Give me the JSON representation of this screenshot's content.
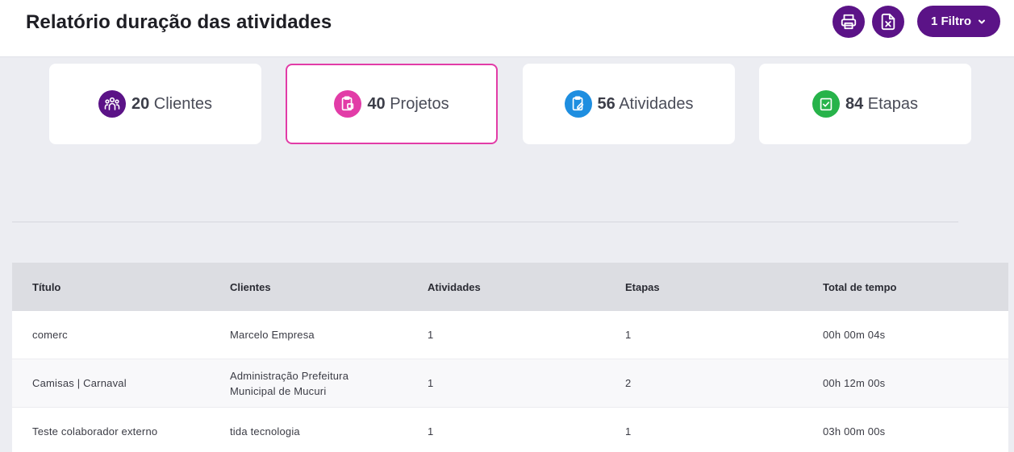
{
  "header": {
    "title": "Relatório duração das atividades",
    "print_icon": "printer-icon",
    "excel_icon": "excel-file-icon",
    "filter_label": "1 Filtro"
  },
  "colors": {
    "brand": "#5b1387",
    "clientes": "#5b1387",
    "projetos": "#e23ca7",
    "atividades": "#1e8ee0",
    "etapas": "#27b34a"
  },
  "cards": [
    {
      "count": "20",
      "label": "Clientes",
      "icon": "users-group-icon"
    },
    {
      "count": "40",
      "label": "Projetos",
      "icon": "clipboard-icon"
    },
    {
      "count": "56",
      "label": "Atividades",
      "icon": "clipboard-edit-icon"
    },
    {
      "count": "84",
      "label": "Etapas",
      "icon": "check-square-icon"
    }
  ],
  "table": {
    "columns": [
      "Título",
      "Clientes",
      "Atividades",
      "Etapas",
      "Total de tempo"
    ],
    "rows": [
      {
        "titulo": "comerc",
        "cliente": "Marcelo Empresa",
        "atividades": "1",
        "etapas": "1",
        "total": "00h 00m 04s"
      },
      {
        "titulo": "Camisas | Carnaval",
        "cliente": "Administração Prefeitura Municipal de Mucuri",
        "atividades": "1",
        "etapas": "2",
        "total": "00h 12m 00s"
      },
      {
        "titulo": "Teste colaborador externo",
        "cliente": "tida tecnologia",
        "atividades": "1",
        "etapas": "1",
        "total": "03h 00m 00s"
      }
    ]
  }
}
